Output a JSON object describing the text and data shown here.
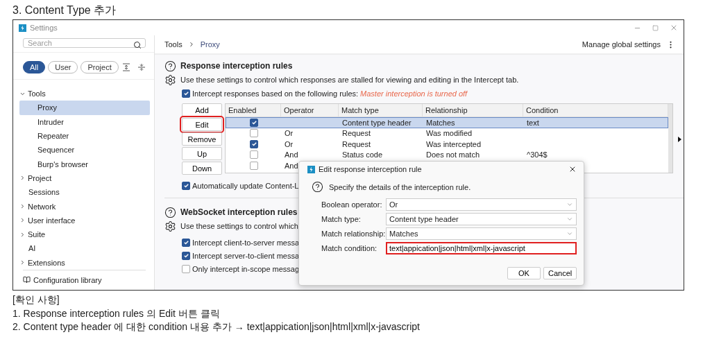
{
  "heading": "3. Content Type 추가",
  "window": {
    "title": "Settings"
  },
  "sidebar": {
    "search": {
      "placeholder": "Search"
    },
    "filters": [
      {
        "label": "All",
        "selected": true
      },
      {
        "label": "User",
        "selected": false
      },
      {
        "label": "Project",
        "selected": false
      }
    ],
    "tree": [
      {
        "label": "Tools",
        "expanded": true,
        "selected": false,
        "children": [
          {
            "label": "Proxy",
            "selected": true
          },
          {
            "label": "Intruder",
            "selected": false
          },
          {
            "label": "Repeater",
            "selected": false
          },
          {
            "label": "Sequencer",
            "selected": false
          },
          {
            "label": "Burp's browser",
            "selected": false
          }
        ]
      },
      {
        "label": "Project",
        "expanded": false,
        "selected": false
      },
      {
        "label": "Sessions",
        "selected": false
      },
      {
        "label": "Network",
        "expanded": false,
        "selected": false
      },
      {
        "label": "User interface",
        "expanded": false,
        "selected": false
      },
      {
        "label": "Suite",
        "expanded": false,
        "selected": false
      },
      {
        "label": "AI",
        "selected": false
      },
      {
        "label": "Extensions",
        "expanded": false,
        "selected": false
      }
    ],
    "footer_link": "Configuration library"
  },
  "breadcrumb": [
    "Tools",
    "Proxy"
  ],
  "manage_label": "Manage global settings",
  "response_rules": {
    "title": "Response interception rules",
    "description": "Use these settings to control which responses are stalled for viewing and editing in the Intercept tab.",
    "intercept": {
      "label": "Intercept responses based on the following rules:",
      "checked": true,
      "warning": "Master interception is turned off"
    },
    "buttons": [
      {
        "label": "Add",
        "highlighted": false
      },
      {
        "label": "Edit",
        "highlighted": true
      },
      {
        "label": "Remove",
        "highlighted": false
      },
      {
        "label": "Up",
        "highlighted": false
      },
      {
        "label": "Down",
        "highlighted": false
      }
    ],
    "table": {
      "columns": [
        "Enabled",
        "Operator",
        "Match type",
        "Relationship",
        "Condition"
      ],
      "rows": [
        {
          "enabled": true,
          "selected": true,
          "match_type": "Content type header",
          "relationship": "Matches",
          "condition": "text"
        },
        {
          "enabled": false,
          "selected": false,
          "operator": "Or",
          "match_type": "Request",
          "relationship": "Was modified"
        },
        {
          "enabled": true,
          "selected": false,
          "operator": "Or",
          "match_type": "Request",
          "relationship": "Was intercepted"
        },
        {
          "enabled": false,
          "selected": false,
          "operator": "And",
          "match_type": "Status code",
          "relationship": "Does not match",
          "condition": "^304$"
        },
        {
          "enabled": false,
          "selected": false,
          "operator": "And"
        }
      ]
    },
    "auto_update": {
      "label": "Automatically update Content-L",
      "checked": true
    }
  },
  "websocket_rules": {
    "title": "WebSocket interception rules",
    "description": "Use these settings to control which",
    "options": [
      {
        "label": "Intercept client-to-server messa",
        "checked": true
      },
      {
        "label": "Intercept server-to-client messa",
        "checked": true
      },
      {
        "label": "Only intercept in-scope messag",
        "checked": false
      }
    ]
  },
  "dialog": {
    "title": "Edit response interception rule",
    "description": "Specify the details of the interception rule.",
    "fields": [
      {
        "label": "Boolean operator:",
        "kind": "dropdown",
        "value": "Or"
      },
      {
        "label": "Match type:",
        "kind": "dropdown",
        "value": "Content type header"
      },
      {
        "label": "Match relationship:",
        "kind": "dropdown",
        "value": "Matches"
      },
      {
        "label": "Match condition:",
        "kind": "text",
        "value": "text|appication|json|html|xml|x-javascript",
        "highlighted": true
      }
    ],
    "buttons": [
      "OK",
      "Cancel"
    ]
  },
  "notes": {
    "title": "[확인 사항]",
    "items": [
      "1. Response interception rules 의 Edit 버튼 클릭",
      "2. Content type header 에 대한 condition 내용 추가 → text|appication|json|html|xml|x-javascript"
    ]
  }
}
